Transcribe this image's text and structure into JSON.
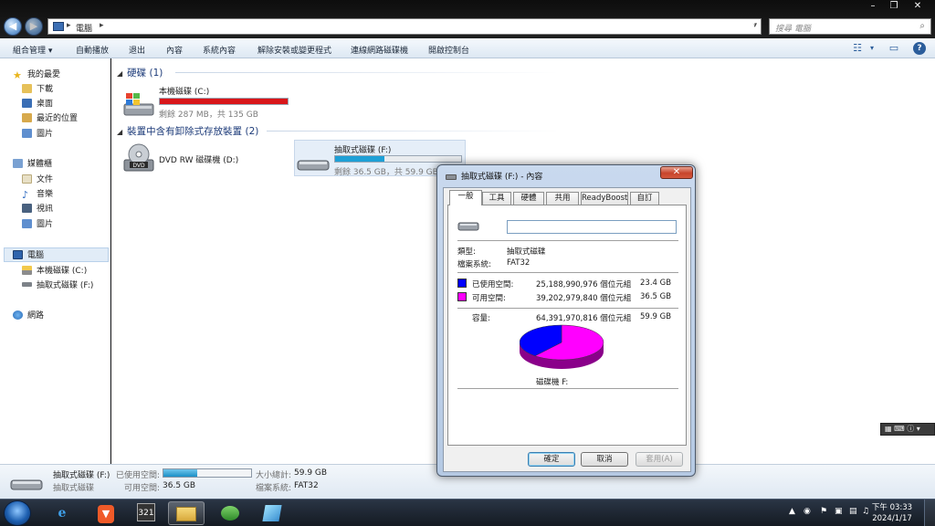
{
  "window": {
    "breadcrumb": "電腦",
    "search_placeholder": "搜尋 電腦",
    "controls": [
      "–",
      "❐",
      "✕"
    ]
  },
  "toolbar": {
    "items": [
      "組合管理 ▾",
      "自動播放",
      "退出",
      "內容",
      "系統內容",
      "解除安裝或變更程式",
      "連線網路磁碟機",
      "開啟控制台"
    ]
  },
  "nav": {
    "favorites": "我的最愛",
    "downloads": "下載",
    "desktop": "桌面",
    "recent": "最近的位置",
    "pictures": "圖片",
    "libraries": "媒體櫃",
    "documents": "文件",
    "music": "音樂",
    "videos": "視訊",
    "lib_pictures": "圖片",
    "computer": "電腦",
    "local_disk": "本機磁碟 (C:)",
    "removable": "抽取式磁碟 (F:)",
    "network": "網路"
  },
  "content": {
    "hdd_group": "硬碟 (1)",
    "removable_group": "裝置中含有卸除式存放裝置 (2)",
    "drive_c": {
      "name": "本機磁碟 (C:)",
      "info": "剩餘 287 MB，共 135 GB",
      "used_fraction": 0.998,
      "bar_color": "#d9161a"
    },
    "drive_d": {
      "name": "DVD RW 磁碟機 (D:)"
    },
    "drive_f": {
      "name": "抽取式磁碟 (F:)",
      "info": "剩餘 36.5 GB，共 59.9 GB",
      "used_fraction": 0.39,
      "bar_color": "#1ea0d6"
    }
  },
  "details": {
    "name": "抽取式磁碟 (F:)",
    "type": "抽取式磁碟",
    "used_label": "已使用空間:",
    "free_label": "可用空間:",
    "free_value": "36.5 GB",
    "total_label": "大小總計:",
    "total_value": "59.9 GB",
    "fs_label": "檔案系統:",
    "fs_value": "FAT32",
    "used_fraction": 0.39
  },
  "dialog": {
    "title": "抽取式磁碟 (F:) - 內容",
    "tabs": [
      "一般",
      "工具",
      "硬體",
      "共用",
      "ReadyBoost",
      "自訂"
    ],
    "name_value": "",
    "type_label": "類型:",
    "type_value": "抽取式磁碟",
    "fs_label": "檔案系統:",
    "fs_value": "FAT32",
    "used_label": "已使用空間:",
    "used_bytes": "25,188,990,976 個位元組",
    "used_gb": "23.4 GB",
    "free_label": "可用空間:",
    "free_bytes": "39,202,979,840 個位元組",
    "free_gb": "36.5 GB",
    "capacity_label": "容量:",
    "capacity_bytes": "64,391,970,816 個位元組",
    "capacity_gb": "59.9 GB",
    "drive_label": "磁碟機 F:",
    "used_fraction": 0.3912,
    "colors": {
      "used": "#0000ff",
      "free": "#ff00ff"
    },
    "buttons": {
      "ok": "確定",
      "cancel": "取消",
      "apply": "套用(A)"
    }
  },
  "taskbar": {
    "apps": [
      "internet-explorer-icon",
      "brave-icon",
      "clock-321-icon",
      "file-explorer-icon",
      "drive-app-icon",
      "notes-app-icon"
    ],
    "time": "下午 03:33",
    "date": "2024/1/17"
  },
  "langbar": "▦ ⌨ ⓘ ▾"
}
